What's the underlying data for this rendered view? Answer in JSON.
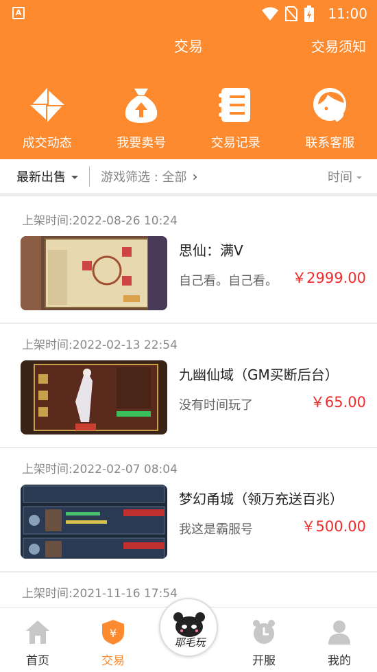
{
  "status_bar": {
    "time": "11:00",
    "app_icon_letter": "A"
  },
  "header": {
    "title": "交易",
    "notice_link": "交易须知"
  },
  "quick_actions": [
    {
      "label": "成交动态",
      "icon": "pinwheel-icon"
    },
    {
      "label": "我要卖号",
      "icon": "money-bag-icon"
    },
    {
      "label": "交易记录",
      "icon": "record-list-icon"
    },
    {
      "label": "联系客服",
      "icon": "customer-service-icon"
    }
  ],
  "filter": {
    "sort_label": "最新出售",
    "game_filter": "游戏筛选 : 全部",
    "time_label": "时间"
  },
  "listings": [
    {
      "date": "上架时间:2022-08-26 10:24",
      "name": "思仙：满V",
      "desc": "自己看。自己看。",
      "price": "￥2999.00"
    },
    {
      "date": "上架时间:2022-02-13 22:54",
      "name": "九幽仙域（GM买断后台）",
      "desc": "没有时间玩了",
      "price": "￥65.00"
    },
    {
      "date": "上架时间:2022-02-07 08:04",
      "name": "梦幻甬城（领万充送百兆）",
      "desc": "我这是霸服号",
      "price": "￥500.00"
    },
    {
      "date": "上架时间:2021-11-16 17:54",
      "name": "",
      "desc": "",
      "price": ""
    }
  ],
  "tabs": [
    {
      "label": "首页",
      "icon": "home-icon"
    },
    {
      "label": "交易",
      "icon": "trade-shield-icon"
    },
    {
      "label": "开服",
      "icon": "alarm-clock-icon"
    },
    {
      "label": "我的",
      "icon": "user-icon"
    }
  ],
  "center_logo_text": "耶毛玩",
  "colors": {
    "accent": "#fd8a2f",
    "price": "#ee2c2c"
  }
}
